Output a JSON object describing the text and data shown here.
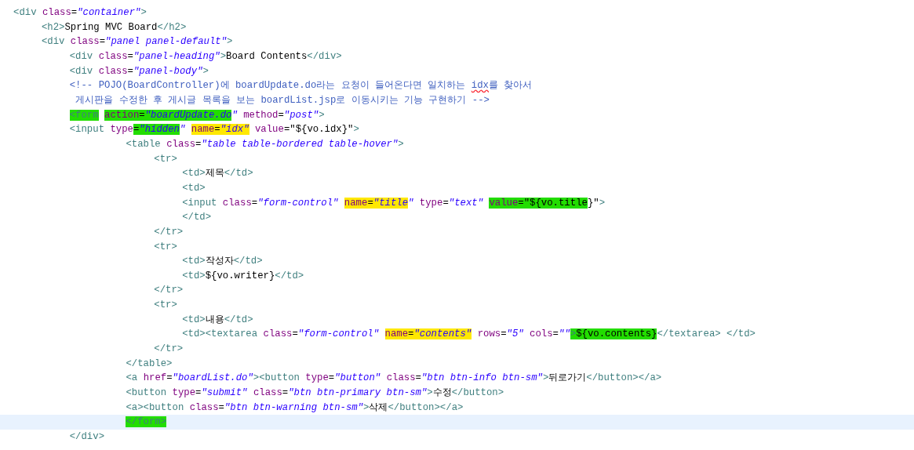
{
  "editor": {
    "lines": [
      {
        "current": false,
        "tokens": [
          {
            "kind": "tag",
            "text": "<div"
          },
          {
            "kind": "attr",
            "text": " class"
          },
          {
            "kind": "punct",
            "text": "="
          },
          {
            "kind": "value",
            "text": "\"container\""
          },
          {
            "kind": "tag",
            "text": ">"
          }
        ]
      },
      {
        "current": false,
        "tokens": [
          {
            "kind": "tag",
            "text": "\t<h2>"
          },
          {
            "kind": "text",
            "text": "Spring MVC Board"
          },
          {
            "kind": "tag",
            "text": "</h2>"
          }
        ]
      },
      {
        "current": false,
        "tokens": [
          {
            "kind": "tag",
            "text": "\t<div"
          },
          {
            "kind": "attr",
            "text": " class"
          },
          {
            "kind": "punct",
            "text": "="
          },
          {
            "kind": "value",
            "text": "\"panel panel-default\""
          },
          {
            "kind": "tag",
            "text": ">"
          }
        ]
      },
      {
        "current": false,
        "tokens": [
          {
            "kind": "tag",
            "text": "\t\t<div"
          },
          {
            "kind": "attr",
            "text": " class"
          },
          {
            "kind": "punct",
            "text": "="
          },
          {
            "kind": "value",
            "text": "\"panel-heading\""
          },
          {
            "kind": "tag",
            "text": ">"
          },
          {
            "kind": "text",
            "text": "Board Contents"
          },
          {
            "kind": "tag",
            "text": "</div>"
          }
        ]
      },
      {
        "current": false,
        "tokens": [
          {
            "kind": "tag",
            "text": "\t\t<div"
          },
          {
            "kind": "attr",
            "text": " class"
          },
          {
            "kind": "punct",
            "text": "="
          },
          {
            "kind": "value",
            "text": "\"panel-body\""
          },
          {
            "kind": "tag",
            "text": ">"
          }
        ]
      },
      {
        "current": false,
        "tokens": [
          {
            "kind": "comment",
            "text": "\t\t<!-- POJO(BoardController)에 boardUpdate.do라는 요청이 들어온다면 일치하는 "
          },
          {
            "kind": "comment",
            "text": "idx",
            "squiggle": true
          },
          {
            "kind": "comment",
            "text": "를 찾아서"
          }
        ]
      },
      {
        "current": false,
        "tokens": [
          {
            "kind": "comment",
            "text": "\t\t 게시판을 수정한 후 게시글 목록을 보는 boardList.jsp로 이동시키는 기능 구현하기 -->"
          }
        ]
      },
      {
        "current": false,
        "tokens": [
          {
            "kind": "tag",
            "text": "\t\t<form",
            "color": "#22dd00"
          },
          {
            "kind": "attr",
            "text": " action",
            "color": "#22dd00"
          },
          {
            "kind": "punct",
            "text": "=",
            "color": "#22dd00"
          },
          {
            "kind": "value",
            "text": "\"boardUpdate.do",
            "color": "#22dd00"
          },
          {
            "kind": "value",
            "text": "\""
          },
          {
            "kind": "attr",
            "text": " method"
          },
          {
            "kind": "punct",
            "text": "="
          },
          {
            "kind": "value",
            "text": "\"post\""
          },
          {
            "kind": "tag",
            "text": ">"
          }
        ]
      },
      {
        "current": false,
        "tokens": [
          {
            "kind": "tag",
            "text": "\t\t<input"
          },
          {
            "kind": "attr",
            "text": " type"
          },
          {
            "kind": "punct",
            "text": "=",
            "color": "#22dd00"
          },
          {
            "kind": "value",
            "text": "\"hidden",
            "color": "#22dd00"
          },
          {
            "kind": "value",
            "text": "\" "
          },
          {
            "kind": "attr",
            "text": "name",
            "color": "#ffe800"
          },
          {
            "kind": "punct",
            "text": "=",
            "color": "#ffe800"
          },
          {
            "kind": "value",
            "text": "\"idx\"",
            "color": "#ffe800"
          },
          {
            "kind": "attr",
            "text": " value"
          },
          {
            "kind": "punct",
            "text": "="
          },
          {
            "kind": "text",
            "text": "\"${vo.idx}\""
          },
          {
            "kind": "tag",
            "text": ">"
          }
        ]
      },
      {
        "current": false,
        "tokens": [
          {
            "kind": "tag",
            "text": "\t\t\t\t<table"
          },
          {
            "kind": "attr",
            "text": " class"
          },
          {
            "kind": "punct",
            "text": "="
          },
          {
            "kind": "value",
            "text": "\"table table-bordered table-hover\""
          },
          {
            "kind": "tag",
            "text": ">"
          }
        ]
      },
      {
        "current": false,
        "tokens": [
          {
            "kind": "tag",
            "text": "\t\t\t\t\t<tr>"
          }
        ]
      },
      {
        "current": false,
        "tokens": [
          {
            "kind": "tag",
            "text": "\t\t\t\t\t\t<td>"
          },
          {
            "kind": "text",
            "text": "제목"
          },
          {
            "kind": "tag",
            "text": "</td>"
          }
        ]
      },
      {
        "current": false,
        "tokens": [
          {
            "kind": "tag",
            "text": "\t\t\t\t\t\t<td>"
          }
        ]
      },
      {
        "current": false,
        "tokens": [
          {
            "kind": "tag",
            "text": "\t\t\t\t\t\t<input"
          },
          {
            "kind": "attr",
            "text": " class"
          },
          {
            "kind": "punct",
            "text": "="
          },
          {
            "kind": "value",
            "text": "\"form-control\" "
          },
          {
            "kind": "attr",
            "text": "name",
            "color": "#ffe800"
          },
          {
            "kind": "punct",
            "text": "=",
            "color": "#ffe800"
          },
          {
            "kind": "value",
            "text": "\"title",
            "color": "#ffe800"
          },
          {
            "kind": "value",
            "text": "\""
          },
          {
            "kind": "attr",
            "text": " type"
          },
          {
            "kind": "punct",
            "text": "="
          },
          {
            "kind": "value",
            "text": "\"text\" "
          },
          {
            "kind": "attr",
            "text": "value",
            "color": "#22dd00"
          },
          {
            "kind": "punct",
            "text": "=",
            "color": "#22dd00"
          },
          {
            "kind": "text",
            "text": "\"${vo.title",
            "color": "#22dd00"
          },
          {
            "kind": "text",
            "text": "}\""
          },
          {
            "kind": "tag",
            "text": ">"
          }
        ]
      },
      {
        "current": false,
        "tokens": [
          {
            "kind": "tag",
            "text": "\t\t\t\t\t\t</td>"
          }
        ]
      },
      {
        "current": false,
        "tokens": [
          {
            "kind": "tag",
            "text": "\t\t\t\t\t</tr>"
          }
        ]
      },
      {
        "current": false,
        "tokens": [
          {
            "kind": "tag",
            "text": "\t\t\t\t\t<tr>"
          }
        ]
      },
      {
        "current": false,
        "tokens": [
          {
            "kind": "tag",
            "text": "\t\t\t\t\t\t<td>"
          },
          {
            "kind": "text",
            "text": "작성자"
          },
          {
            "kind": "tag",
            "text": "</td>"
          }
        ]
      },
      {
        "current": false,
        "tokens": [
          {
            "kind": "tag",
            "text": "\t\t\t\t\t\t<td>"
          },
          {
            "kind": "text",
            "text": "${vo.writer}"
          },
          {
            "kind": "tag",
            "text": "</td>"
          }
        ]
      },
      {
        "current": false,
        "tokens": [
          {
            "kind": "tag",
            "text": "\t\t\t\t\t</tr>"
          }
        ]
      },
      {
        "current": false,
        "tokens": [
          {
            "kind": "tag",
            "text": "\t\t\t\t\t<tr>"
          }
        ]
      },
      {
        "current": false,
        "tokens": [
          {
            "kind": "tag",
            "text": "\t\t\t\t\t\t<td>"
          },
          {
            "kind": "text",
            "text": "내용"
          },
          {
            "kind": "tag",
            "text": "</td>"
          }
        ]
      },
      {
        "current": false,
        "tokens": [
          {
            "kind": "tag",
            "text": "\t\t\t\t\t\t<td><textarea"
          },
          {
            "kind": "attr",
            "text": " class"
          },
          {
            "kind": "punct",
            "text": "="
          },
          {
            "kind": "value",
            "text": "\"form-control\" "
          },
          {
            "kind": "attr",
            "text": "name",
            "color": "#ffe800"
          },
          {
            "kind": "punct",
            "text": "=",
            "color": "#ffe800"
          },
          {
            "kind": "value",
            "text": "\"contents\"",
            "color": "#ffe800"
          },
          {
            "kind": "attr",
            "text": " rows"
          },
          {
            "kind": "punct",
            "text": "="
          },
          {
            "kind": "value",
            "text": "\"5\""
          },
          {
            "kind": "attr",
            "text": " cols"
          },
          {
            "kind": "punct",
            "text": "="
          },
          {
            "kind": "value",
            "text": "\"\""
          },
          {
            "kind": "tag",
            "text": ">",
            "color": "#22dd00"
          },
          {
            "kind": "text",
            "text": "${vo.contents}",
            "color": "#22dd00"
          },
          {
            "kind": "tag",
            "text": "</textarea> </td>"
          }
        ]
      },
      {
        "current": false,
        "tokens": [
          {
            "kind": "tag",
            "text": "\t\t\t\t\t</tr>"
          }
        ]
      },
      {
        "current": false,
        "tokens": [
          {
            "kind": "tag",
            "text": "\t\t\t\t</table>"
          }
        ]
      },
      {
        "current": false,
        "tokens": [
          {
            "kind": "tag",
            "text": "\t\t\t\t<a"
          },
          {
            "kind": "attr",
            "text": " href"
          },
          {
            "kind": "punct",
            "text": "="
          },
          {
            "kind": "value",
            "text": "\"boardList.do\""
          },
          {
            "kind": "tag",
            "text": "><button"
          },
          {
            "kind": "attr",
            "text": " type"
          },
          {
            "kind": "punct",
            "text": "="
          },
          {
            "kind": "value",
            "text": "\"button\""
          },
          {
            "kind": "attr",
            "text": " class"
          },
          {
            "kind": "punct",
            "text": "="
          },
          {
            "kind": "value",
            "text": "\"btn btn-info btn-sm\""
          },
          {
            "kind": "tag",
            "text": ">"
          },
          {
            "kind": "text",
            "text": "뒤로가기"
          },
          {
            "kind": "tag",
            "text": "</button></a>"
          }
        ]
      },
      {
        "current": false,
        "tokens": [
          {
            "kind": "tag",
            "text": "\t\t\t\t<button"
          },
          {
            "kind": "attr",
            "text": " type"
          },
          {
            "kind": "punct",
            "text": "="
          },
          {
            "kind": "value",
            "text": "\"submit\""
          },
          {
            "kind": "attr",
            "text": " class"
          },
          {
            "kind": "punct",
            "text": "="
          },
          {
            "kind": "value",
            "text": "\"btn btn-primary btn-sm\""
          },
          {
            "kind": "tag",
            "text": ">"
          },
          {
            "kind": "text",
            "text": "수정"
          },
          {
            "kind": "tag",
            "text": "</button>"
          }
        ]
      },
      {
        "current": false,
        "tokens": [
          {
            "kind": "tag",
            "text": "\t\t\t\t<a><button"
          },
          {
            "kind": "attr",
            "text": " class"
          },
          {
            "kind": "punct",
            "text": "="
          },
          {
            "kind": "value",
            "text": "\"btn btn-warning btn-sm\""
          },
          {
            "kind": "tag",
            "text": ">"
          },
          {
            "kind": "text",
            "text": "삭제"
          },
          {
            "kind": "tag",
            "text": "</button></a>"
          }
        ]
      },
      {
        "current": true,
        "tokens": [
          {
            "kind": "tag",
            "text": "\t\t\t\t</form>",
            "color": "#22dd00"
          }
        ]
      },
      {
        "current": false,
        "tokens": [
          {
            "kind": "tag",
            "text": "\t\t</div>"
          }
        ]
      }
    ]
  }
}
